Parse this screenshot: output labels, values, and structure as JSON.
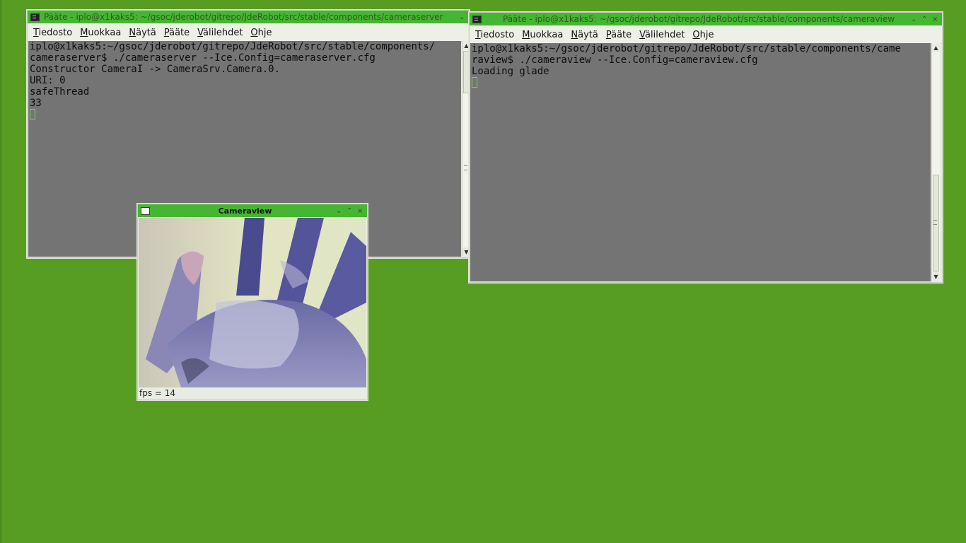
{
  "terminal_server": {
    "title": "Pääte - iplo@x1kaks5: ~/gsoc/jderobot/gitrepo/JdeRobot/src/stable/components/cameraserver",
    "menu": [
      "Tiedosto",
      "Muokkaa",
      "Näytä",
      "Pääte",
      "Välilehdet",
      "Ohje"
    ],
    "lines": [
      "iplo@x1kaks5:~/gsoc/jderobot/gitrepo/JdeRobot/src/stable/components/",
      "cameraserver$ ./cameraserver --Ice.Config=cameraserver.cfg",
      "Constructor CameraI -> CameraSrv.Camera.0.",
      "URI: 0",
      "safeThread",
      "33"
    ]
  },
  "terminal_view": {
    "title": "Pääte - iplo@x1kaks5: ~/gsoc/jderobot/gitrepo/JdeRobot/src/stable/components/cameraview",
    "menu": [
      "Tiedosto",
      "Muokkaa",
      "Näytä",
      "Pääte",
      "Välilehdet",
      "Ohje"
    ],
    "lines": [
      "iplo@x1kaks5:~/gsoc/jderobot/gitrepo/JdeRobot/src/stable/components/came",
      "raview$ ./cameraview --Ice.Config=cameraview.cfg",
      "Loading glade"
    ]
  },
  "cameraview": {
    "title": "Cameraview",
    "status": "fps = 14"
  },
  "window_buttons": {
    "minimize": "⌄",
    "maximize": "⌃",
    "close": "×"
  },
  "colors": {
    "desktop": "#579d22",
    "titlebar": "#45b631",
    "terminal_bg": "#747474"
  }
}
